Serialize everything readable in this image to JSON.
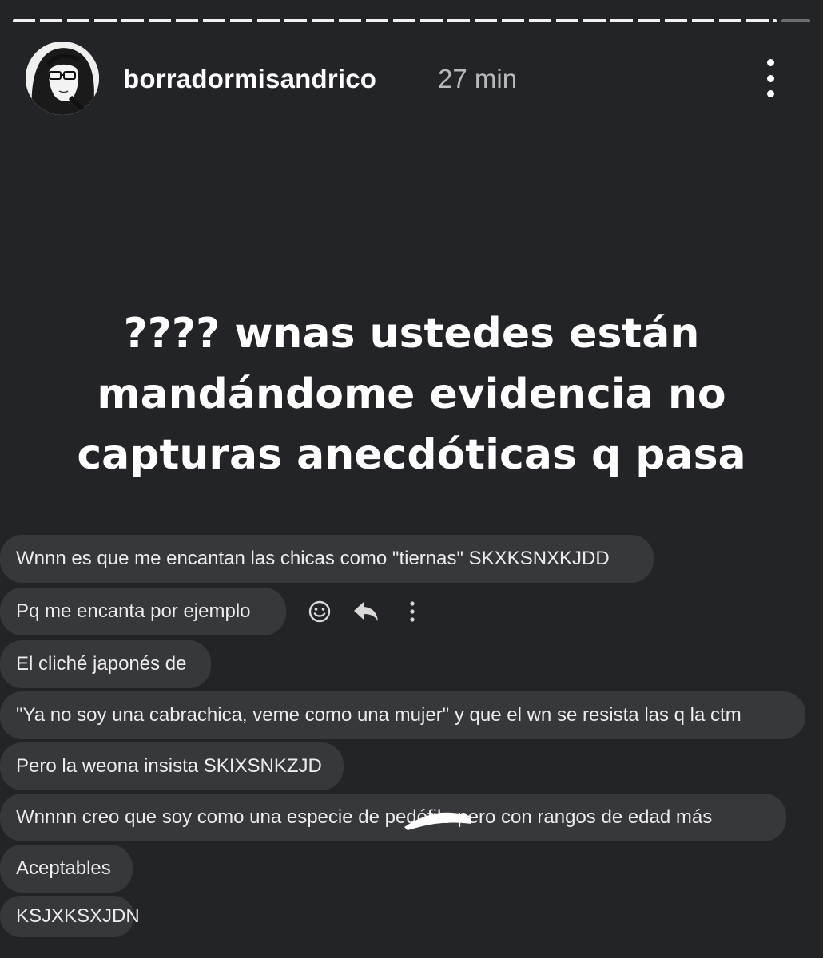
{
  "story": {
    "username": "borradormisandrico",
    "timestamp": "27 min",
    "caption": "???? wnas ustedes están mandándome evidencia no capturas anecdóticas q pasa"
  },
  "icons": {
    "menu": "more-vertical-icon",
    "react": "smiley-icon",
    "reply": "reply-icon",
    "message_menu": "more-vertical-icon"
  },
  "messages": [
    {
      "text": "Wnnn es que me encantan las chicas como \"tiernas\" SKXKSNXKJDD"
    },
    {
      "text": "Pq me encanta por ejemplo"
    },
    {
      "text": "El cliché japonés de"
    },
    {
      "text": "\"Ya no soy una cabrachica, veme como una mujer\" y que el wn se resista las q la ctm"
    },
    {
      "text": "Pero la weona insista SKIXSNKZJD"
    },
    {
      "text": "Wnnnn creo que soy como una especie de pedófilo pero con rangos de edad más"
    },
    {
      "text": "Aceptables"
    },
    {
      "text": "KSJXKSXJDN"
    }
  ],
  "colors": {
    "background": "#232427",
    "bubble": "#37383c",
    "text": "#ffffff",
    "muted": "#b8b9bc"
  }
}
